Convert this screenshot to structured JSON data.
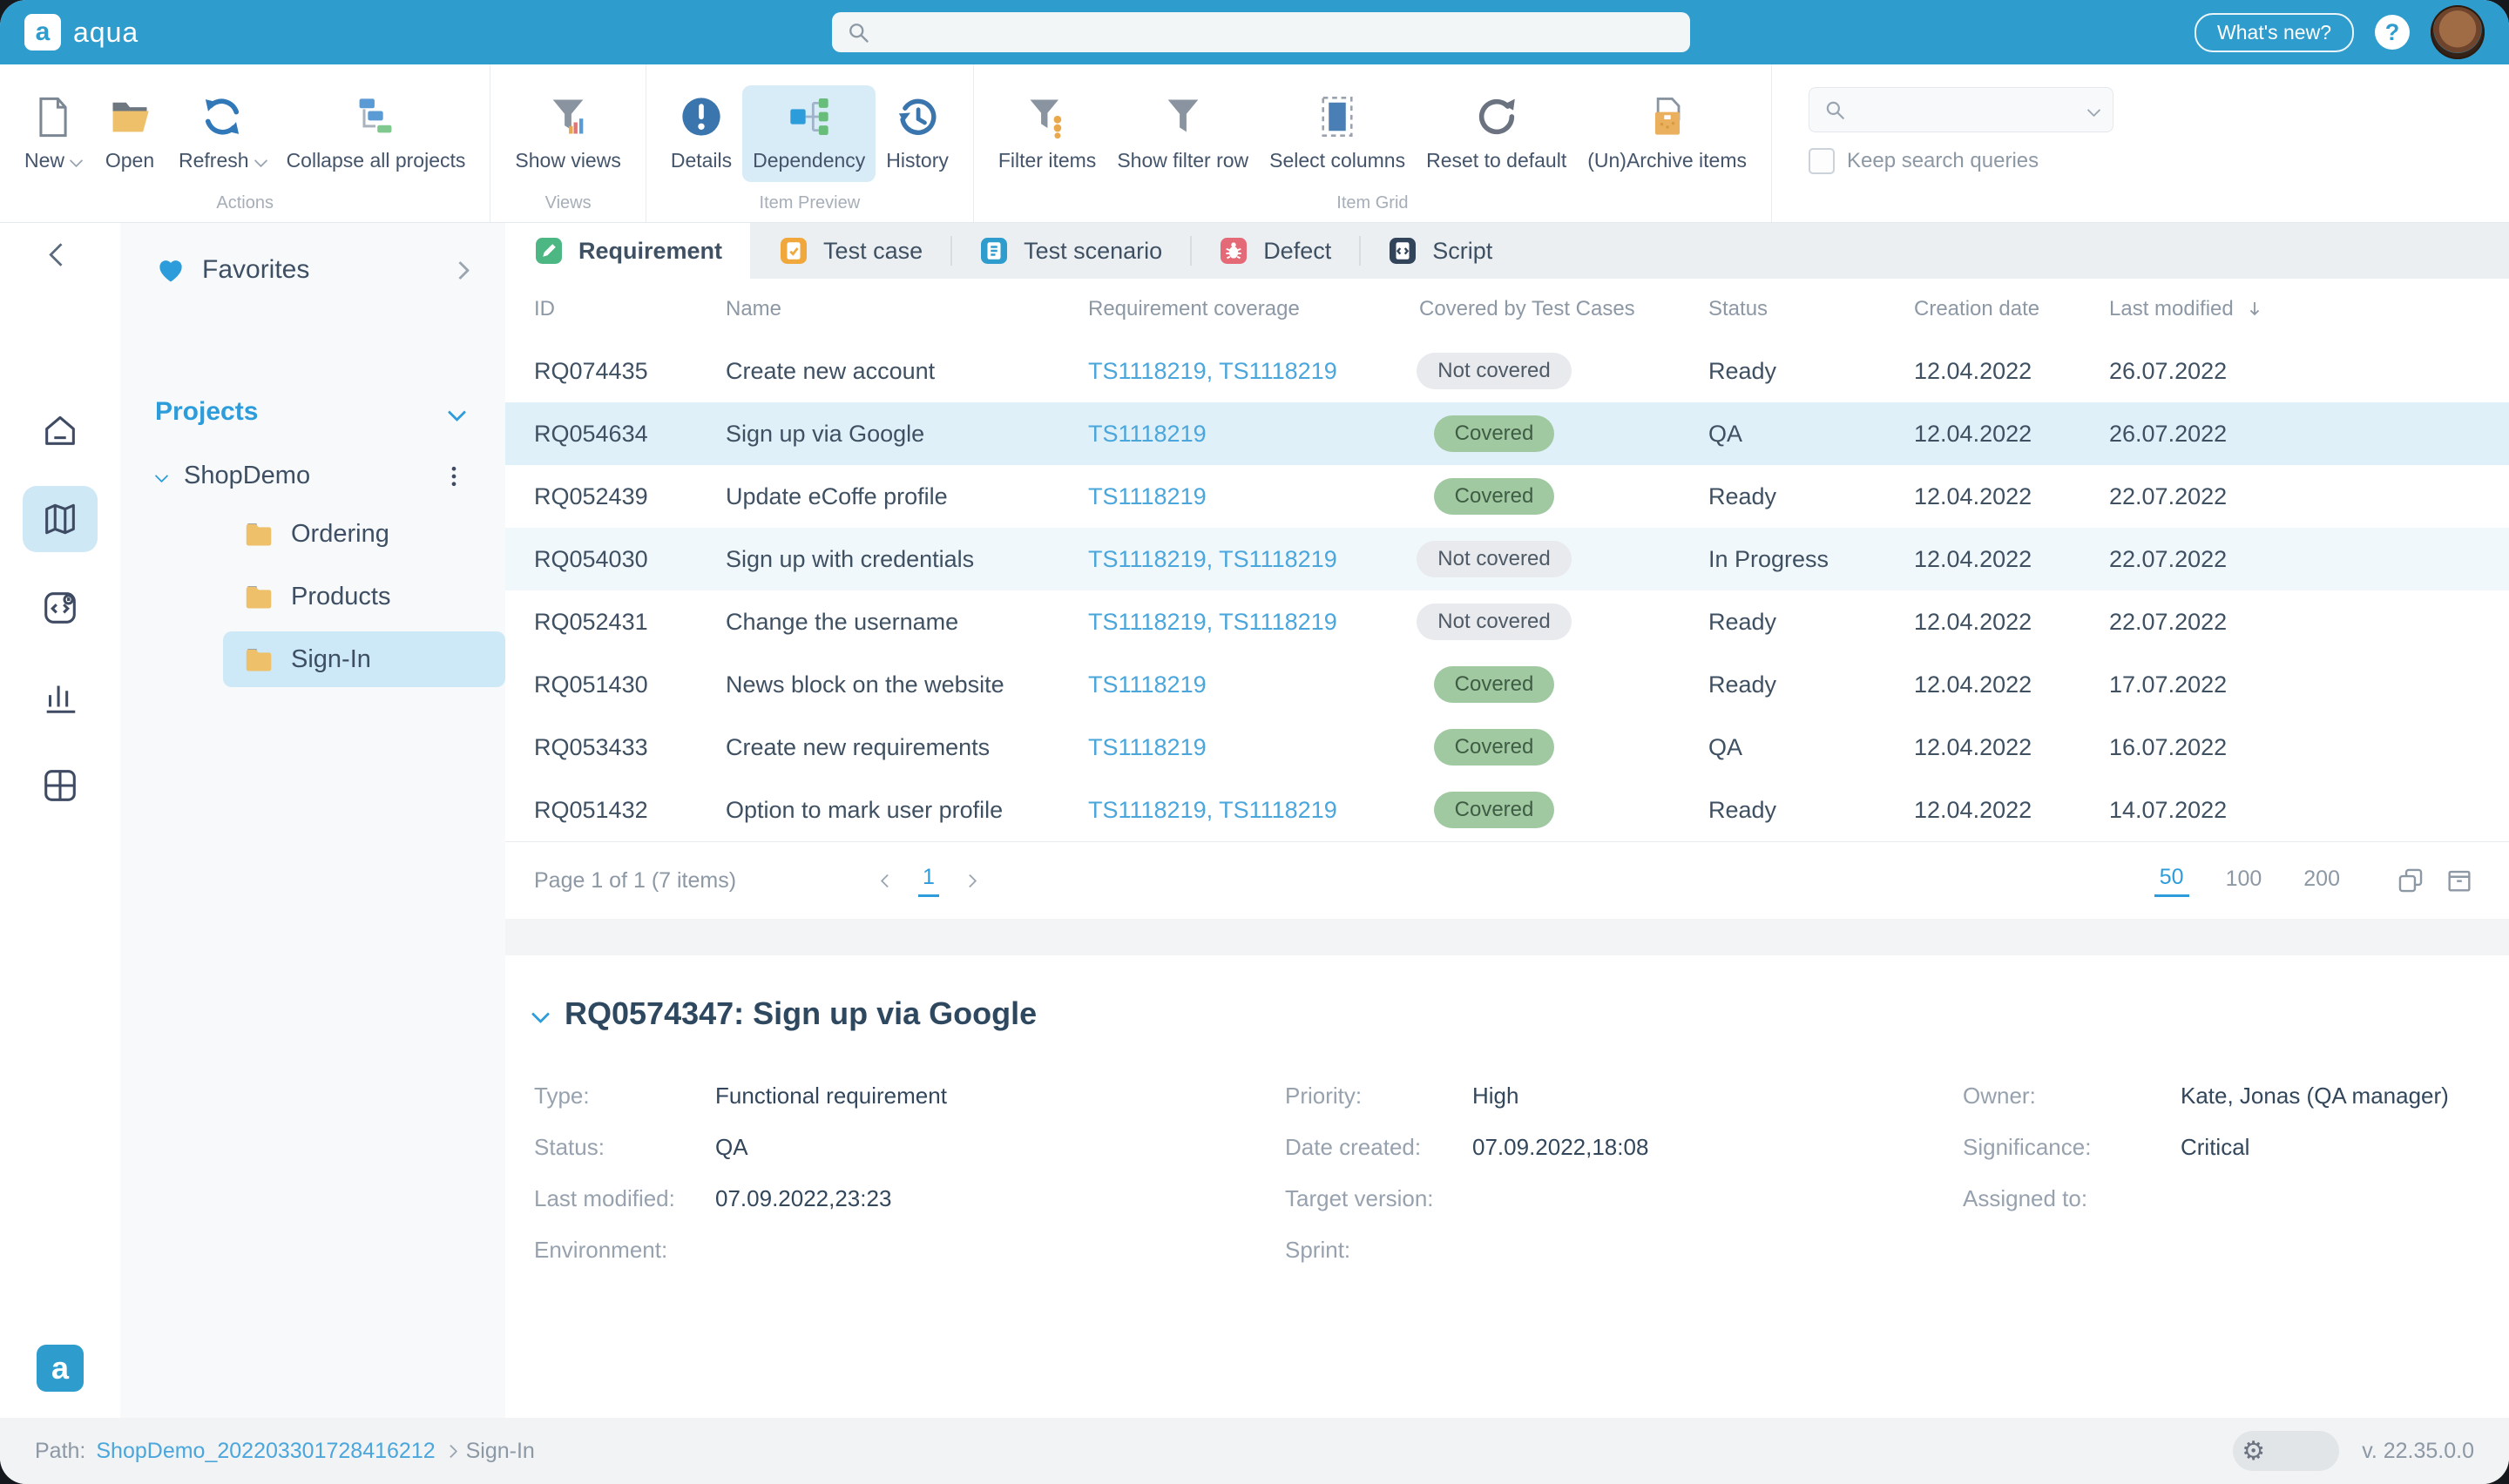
{
  "colors": {
    "accent": "#2d9cdb",
    "topbar": "#2e9ccd",
    "covered_bg": "#a1c9a1",
    "covered_text": "#3f5d44",
    "not_covered_bg": "#e8eaed",
    "not_covered_text": "#4e5a66",
    "selected_row": "#dff0f9"
  },
  "topbar": {
    "logo_letter": "a",
    "brand": "aqua",
    "whats_new": "What's new?",
    "help": "?"
  },
  "toolbar": {
    "group_labels": {
      "actions": "Actions",
      "views": "Views",
      "item_preview": "Item Preview",
      "item_grid": "Item Grid"
    },
    "buttons": {
      "new": {
        "label": "New"
      },
      "open": {
        "label": "Open"
      },
      "refresh": {
        "label": "Refresh"
      },
      "collapse": {
        "label": "Collapse all projects"
      },
      "show_views": {
        "label": "Show views"
      },
      "details": {
        "label": "Details"
      },
      "dependency": {
        "label": "Dependency"
      },
      "history": {
        "label": "History"
      },
      "filter_items": {
        "label": "Filter items"
      },
      "show_filter_row": {
        "label": "Show filter row"
      },
      "select_columns": {
        "label": "Select columns"
      },
      "reset": {
        "label": "Reset to default"
      },
      "unarchive": {
        "label": "(Un)Archive items"
      }
    },
    "keep_search": "Keep search queries"
  },
  "sidebar": {
    "favorites": "Favorites",
    "projects": "Projects",
    "tree": {
      "project": "ShopDemo",
      "folders": [
        "Ordering",
        "Products",
        "Sign-In"
      ],
      "selected_index": 2
    }
  },
  "tabs": [
    {
      "label": "Requirement",
      "icon": "requirement-icon",
      "color": "#4cb782",
      "active": true
    },
    {
      "label": "Test case",
      "icon": "test-case-icon",
      "color": "#f0a83c",
      "active": false
    },
    {
      "label": "Test scenario",
      "icon": "test-scenario-icon",
      "color": "#2e9ccd",
      "active": false
    },
    {
      "label": "Defect",
      "icon": "defect-icon",
      "color": "#e56a78",
      "active": false
    },
    {
      "label": "Script",
      "icon": "script-icon",
      "color": "#31445a",
      "active": false
    }
  ],
  "table": {
    "columns": [
      "ID",
      "Name",
      "Requirement coverage",
      "Covered by Test Cases",
      "Status",
      "Creation date",
      "Last modified"
    ],
    "sort": {
      "column": "Last modified",
      "direction": "desc"
    },
    "rows": [
      {
        "id": "RQ074435",
        "name": "Create new account",
        "coverage": "TS1118219, TS1118219",
        "covered_label": "Not covered",
        "covered": false,
        "status": "Ready",
        "created": "12.04.2022",
        "modified": "26.07.2022",
        "highlight": "none"
      },
      {
        "id": "RQ054634",
        "name": "Sign up via Google",
        "coverage": "TS1118219",
        "covered_label": "Covered",
        "covered": true,
        "status": "QA",
        "created": "12.04.2022",
        "modified": "26.07.2022",
        "highlight": "selected"
      },
      {
        "id": "RQ052439",
        "name": "Update eCoffe profile",
        "coverage": "TS1118219",
        "covered_label": "Covered",
        "covered": true,
        "status": "Ready",
        "created": "12.04.2022",
        "modified": "22.07.2022",
        "highlight": "none"
      },
      {
        "id": "RQ054030",
        "name": "Sign up with credentials",
        "coverage": "TS1118219, TS1118219",
        "covered_label": "Not covered",
        "covered": false,
        "status": "In Progress",
        "created": "12.04.2022",
        "modified": "22.07.2022",
        "highlight": "tinted"
      },
      {
        "id": "RQ052431",
        "name": "Change the username",
        "coverage": "TS1118219, TS1118219",
        "covered_label": "Not covered",
        "covered": false,
        "status": "Ready",
        "created": "12.04.2022",
        "modified": "22.07.2022",
        "highlight": "none"
      },
      {
        "id": "RQ051430",
        "name": "News block on the website",
        "coverage": "TS1118219",
        "covered_label": "Covered",
        "covered": true,
        "status": "Ready",
        "created": "12.04.2022",
        "modified": "17.07.2022",
        "highlight": "none"
      },
      {
        "id": "RQ053433",
        "name": "Create new requirements",
        "coverage": "TS1118219",
        "covered_label": "Covered",
        "covered": true,
        "status": "QA",
        "created": "12.04.2022",
        "modified": "16.07.2022",
        "highlight": "none"
      },
      {
        "id": "RQ051432",
        "name": "Option to mark user profile",
        "coverage": "TS1118219, TS1118219",
        "covered_label": "Covered",
        "covered": true,
        "status": "Ready",
        "created": "12.04.2022",
        "modified": "14.07.2022",
        "highlight": "none"
      }
    ]
  },
  "pagination": {
    "summary": "Page 1 of 1 (7 items)",
    "page": "1",
    "sizes": [
      "50",
      "100",
      "200"
    ],
    "active_size": "50"
  },
  "detail": {
    "title": "RQ0574347: Sign up via Google",
    "columns": [
      [
        {
          "label": "Type:",
          "value": "Functional requirement"
        },
        {
          "label": "Status:",
          "value": "QA"
        },
        {
          "label": "Last modified:",
          "value": "07.09.2022,23:23"
        },
        {
          "label": "Environment:",
          "value": ""
        }
      ],
      [
        {
          "label": "Priority:",
          "value": "High"
        },
        {
          "label": "Date created:",
          "value": "07.09.2022,18:08"
        },
        {
          "label": "Target version:",
          "value": ""
        },
        {
          "label": "Sprint:",
          "value": ""
        }
      ],
      [
        {
          "label": "Owner:",
          "value": "Kate, Jonas (QA manager)"
        },
        {
          "label": "Significance:",
          "value": "Critical"
        },
        {
          "label": "Assigned to:",
          "value": ""
        }
      ]
    ]
  },
  "footer": {
    "path_label": "Path:",
    "path_link": "ShopDemo_202203301728416212",
    "path_current": "Sign-In",
    "version": "v. 22.35.0.0"
  }
}
